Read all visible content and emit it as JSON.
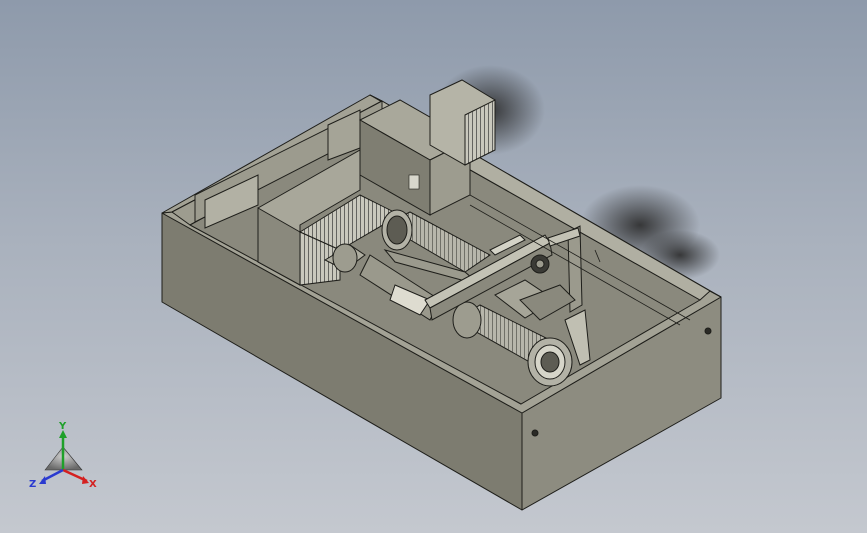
{
  "viewport": {
    "background_top": "#8e9aab",
    "background_bottom": "#c4c8cf",
    "model_color": "#87867a",
    "edge_color": "#1e1e1a"
  },
  "triad": {
    "x_label": "X",
    "y_label": "Y",
    "z_label": "Z",
    "x_color": "#d42020",
    "y_color": "#1fa02a",
    "z_color": "#2a3ad0"
  }
}
